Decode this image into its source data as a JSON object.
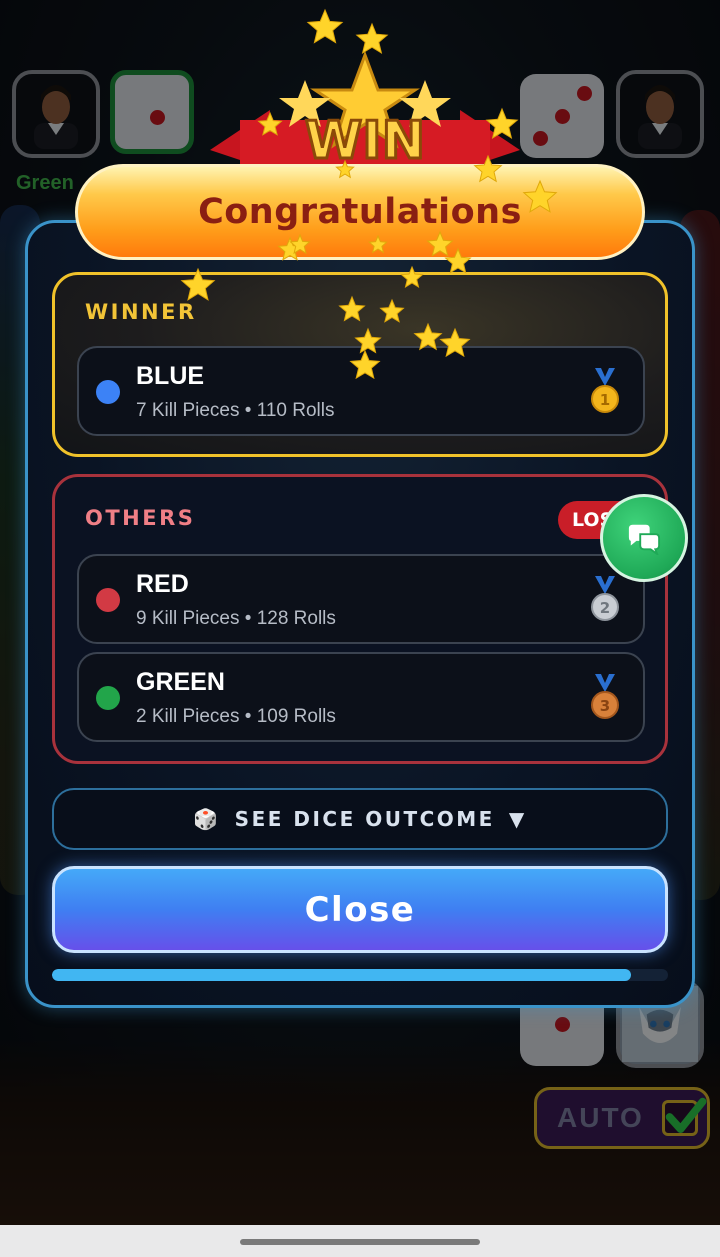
{
  "header": {
    "left_player_label": "Green",
    "win_emblem_text": "WIN",
    "congrats_title": "Congratulations"
  },
  "winner_section": {
    "title": "WINNER",
    "player": {
      "name": "BLUE",
      "stats": "7 Kill Pieces • 110 Rolls",
      "dot_color": "#3c82f6",
      "medal": "1"
    }
  },
  "others_section": {
    "title": "OTHERS",
    "badge": "LOS",
    "players": [
      {
        "name": "RED",
        "stats": "9 Kill Pieces • 128 Rolls",
        "dot_color": "#d23a44",
        "medal": "2"
      },
      {
        "name": "GREEN",
        "stats": "2 Kill Pieces • 109 Rolls",
        "dot_color": "#22a54a",
        "medal": "3"
      }
    ]
  },
  "dice_outcome": {
    "icon": "🎲",
    "label": "SEE DICE OUTCOME",
    "arrow": "▼"
  },
  "close_button": {
    "label": "Close"
  },
  "progress": {
    "fraction": 0.94
  },
  "auto_button": {
    "label": "AUTO",
    "checked": true
  },
  "colors": {
    "accent_blue": "#3a93c9",
    "winner_border": "#f0c22a",
    "others_border": "#a8323c",
    "chat_green": "#1fa957"
  }
}
